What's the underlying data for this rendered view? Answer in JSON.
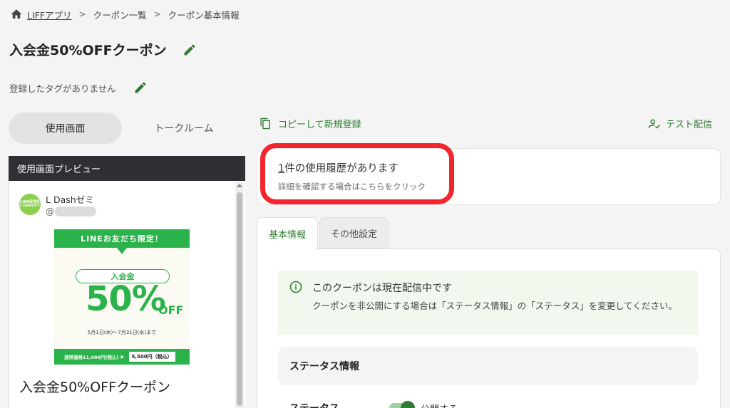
{
  "breadcrumb": {
    "home_link": "LIFFアプリ",
    "item2": "クーポン一覧",
    "item3": "クーポン基本情報",
    "separator": ">"
  },
  "page": {
    "title": "入会金50%OFFクーポン",
    "tags_empty": "登録したタグがありません"
  },
  "view_toggle": {
    "active": "使用画面",
    "inactive": "トークルーム"
  },
  "preview": {
    "header": "使用画面プレビュー",
    "account_name": "L Dashゼミ",
    "account_id_prefix": "@",
    "avatar_line1": "LINE研究所",
    "avatar_line2": "L Dashゼミ",
    "coupon_banner": "LINEお友だち限定！",
    "coupon_join": "入会金",
    "coupon_pct": "50%",
    "coupon_off": "OFF",
    "coupon_period": "5月1日(水)〜7月31日(水)まで",
    "coupon_regular": "通常価格11,000円(税込)",
    "coupon_arrow": "▶",
    "coupon_new_price": "5,500円（税込）",
    "title": "入会金50%OFFクーポン"
  },
  "actions": {
    "copy": "コピーして新規登録",
    "test": "テスト配信"
  },
  "history": {
    "count": "1",
    "main_rest": "件の使用履歴があります",
    "sub": "詳細を確認する場合はこちらをクリック"
  },
  "tabs": {
    "basic": "基本情報",
    "other": "その他設定"
  },
  "notice": {
    "title": "このクーポンは現在配信中です",
    "text": "クーポンを非公開にする場合は「ステータス情報」の「ステータス」を変更してください。"
  },
  "status": {
    "section_title": "ステータス情報",
    "label": "ステータス",
    "switch_label": "公開する"
  },
  "colors": {
    "accent": "#2e7d32",
    "highlight": "#f2262c",
    "coupon_green": "#2bb34b"
  }
}
